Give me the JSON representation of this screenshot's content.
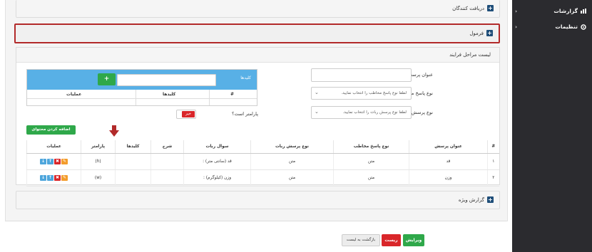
{
  "sidebar": {
    "items": [
      {
        "label": "گزارشات"
      },
      {
        "label": "تنظیمات"
      }
    ]
  },
  "panels": {
    "recipients": "دریافت کنندگان",
    "formula": "فرمول",
    "special_report": "گزارش ویژه"
  },
  "steps": {
    "title": "لیست مراحل فرایند",
    "question_title_label": "عنوان پرسش",
    "answer_type_label": "نوع پاسخ مخاطب",
    "answer_type_placeholder": "لطفا نوع پاسخ مخاطب را انتخاب نمایید.",
    "bot_question_type_label": "نوع پرسش ربات",
    "bot_question_type_placeholder": "لطفا نوع پرسش ربات را انتخاب نمایید.",
    "keywords": {
      "title": "کلیدها",
      "col_num": "#",
      "col_keys": "کلیدها",
      "col_ops": "عملیات",
      "add_label": "+"
    },
    "is_parameter_label": "پارامتر است؟",
    "is_parameter_value": "خیر",
    "add_button": "اضافه کردن محتوای دکمه"
  },
  "table": {
    "headers": [
      "#",
      "عنوان پرسش",
      "نوع پاسخ مخاطب",
      "نوع پرسش ربات",
      "سوال ربات",
      "شرح",
      "کلیدها",
      "پارامتر",
      "عملیات"
    ],
    "rows": [
      {
        "num": "۱",
        "title": "قد",
        "answer_type": "متن",
        "bot_type": "متن",
        "bot_question": "قد (سانتی متر) :",
        "desc": "",
        "keys": "",
        "param": "(h)"
      },
      {
        "num": "۲",
        "title": "وزن",
        "answer_type": "متن",
        "bot_type": "متن",
        "bot_question": "وزن (کیلوگرم) :",
        "desc": "",
        "keys": "",
        "param": "(w)"
      }
    ]
  },
  "footer": {
    "edit": "ویرایش",
    "reset": "ریست",
    "back": "بازگشت به لیست"
  },
  "colors": {
    "accent_blue": "#58b0e6",
    "green": "#2fa84a",
    "red": "#d9262a",
    "highlight_border": "#b22a2a",
    "sidebar_bg": "#2b2b2f"
  }
}
